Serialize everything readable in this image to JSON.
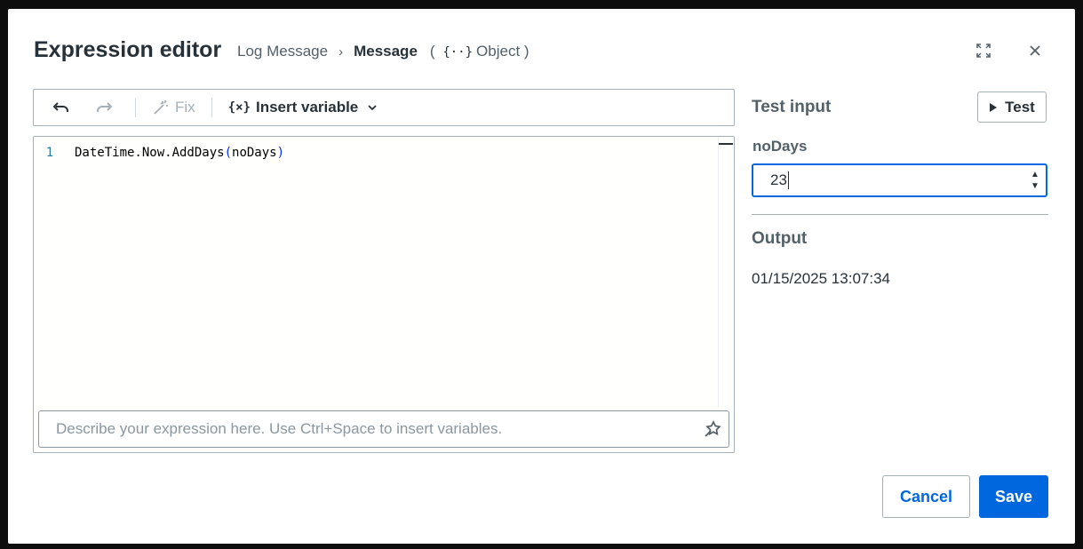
{
  "dialog": {
    "title": "Expression editor",
    "breadcrumb": {
      "parent": "Log Message",
      "separator": "›",
      "current": "Message",
      "type_open": "(",
      "type_braces": "{··}",
      "type_name": "Object",
      "type_close": ")"
    },
    "icons": {
      "expand": "expand-icon",
      "close": "close-icon"
    }
  },
  "toolbar": {
    "undo_icon": "undo-icon",
    "redo_icon": "redo-icon",
    "fix_label": "Fix",
    "insert_variable_icon": "{×}",
    "insert_variable_label": "Insert variable"
  },
  "editor": {
    "line_numbers": [
      "1"
    ],
    "code": {
      "prefix": "DateTime.Now.AddDays",
      "open_paren": "(",
      "argument": "noDays",
      "close_paren": ")"
    },
    "describe_placeholder": "Describe your expression here. Use Ctrl+Space to insert variables."
  },
  "test_panel": {
    "heading": "Test input",
    "test_button_label": "Test",
    "variable_label": "noDays",
    "variable_value": "23",
    "output_heading": "Output",
    "output_value": "01/15/2025 13:07:34"
  },
  "footer": {
    "cancel_label": "Cancel",
    "save_label": "Save"
  },
  "colors": {
    "primary": "#0067df",
    "text": "#273139",
    "muted": "#526069",
    "border": "#a4b1b8"
  }
}
